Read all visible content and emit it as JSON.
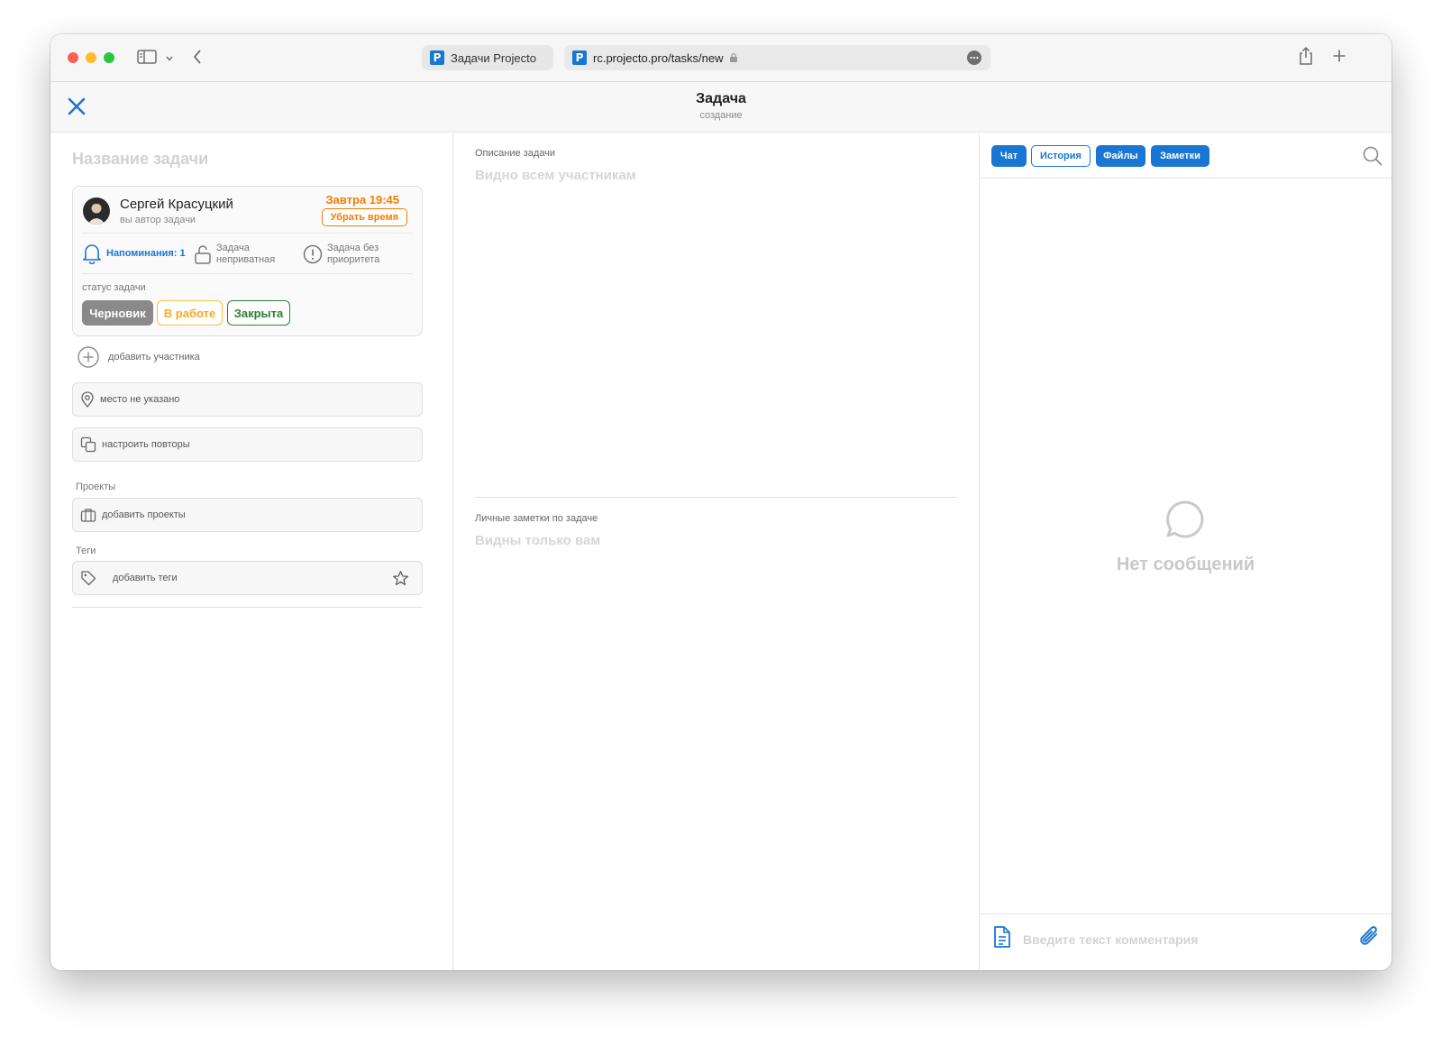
{
  "browser": {
    "tab_title": "Задачи Projecto",
    "favicon_letter": "P",
    "address": "rc.projecto.pro/tasks/new",
    "accent": "#1976d2"
  },
  "header": {
    "title": "Задача",
    "subtitle": "создание"
  },
  "left": {
    "task_name_placeholder": "Название задачи",
    "author": {
      "name": "Сергей Красуцкий",
      "role": "вы автор задачи"
    },
    "due": "Завтра 19:45",
    "remove_time_label": "Убрать время",
    "options": {
      "reminders": "Напоминания: 1",
      "privacy_line1": "Задача",
      "privacy_line2": "неприватная",
      "priority_line1": "Задача без",
      "priority_line2": "приоритета"
    },
    "status_label": "статус задачи",
    "statuses": [
      {
        "label": "Черновик",
        "state": "selected"
      },
      {
        "label": "В работе",
        "state": "outline"
      },
      {
        "label": "Закрыта",
        "state": "outline"
      }
    ],
    "add_participant": "добавить участника",
    "place": "место не указано",
    "repeats": "настроить повторы",
    "projects_label": "Проекты",
    "projects_add": "добавить проекты",
    "tags_label": "Теги",
    "tags_add": "добавить теги"
  },
  "middle": {
    "description_label": "Описание задачи",
    "description_placeholder": "Видно всем участникам",
    "notes_label": "Личные заметки по задаче",
    "notes_placeholder": "Видны только вам"
  },
  "right": {
    "tabs": [
      {
        "label": "Чат",
        "active": true
      },
      {
        "label": "История",
        "active": false
      },
      {
        "label": "Файлы",
        "active": true
      },
      {
        "label": "Заметки",
        "active": true
      }
    ],
    "empty_text": "Нет сообщений",
    "comment_placeholder": "Введите текст комментария"
  },
  "colors": {
    "blue": "#1976d2",
    "orange": "#f57c00",
    "yellow": "#f9a825",
    "green": "#2e7d32",
    "gray_chip": "#8a8a8a"
  }
}
